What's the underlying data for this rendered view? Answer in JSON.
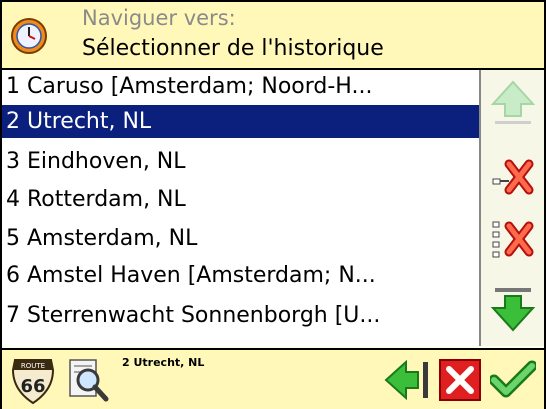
{
  "header": {
    "subtitle": "Naviguer vers:",
    "title": "Sélectionner de l'historique"
  },
  "history": {
    "items": [
      "1 Caruso [Amsterdam; Noord-H...",
      "2 Utrecht, NL",
      "3 Eindhoven, NL",
      "4 Rotterdam, NL",
      "5 Amsterdam, NL",
      "6 Amstel Haven [Amsterdam; N...",
      "7 Sterrenwacht Sonnenborgh [U..."
    ],
    "selected_index": 1
  },
  "footer": {
    "selected_label": "2 Utrecht, NL",
    "route_badge": "66",
    "route_badge_top": "ROUTE"
  },
  "icons": {
    "clock": "clock-icon",
    "scroll_up": "arrow-up-icon",
    "delete_one": "delete-item-icon",
    "delete_all": "delete-all-icon",
    "scroll_down": "arrow-down-icon",
    "route": "route-66-icon",
    "inspect": "magnifier-icon",
    "back": "back-arrow-icon",
    "cancel": "close-icon",
    "confirm": "checkmark-icon"
  },
  "colors": {
    "selection": "#0b1f7c",
    "header_bg": "#fff8b8",
    "green": "#3bbf3b",
    "red": "#e02020"
  }
}
